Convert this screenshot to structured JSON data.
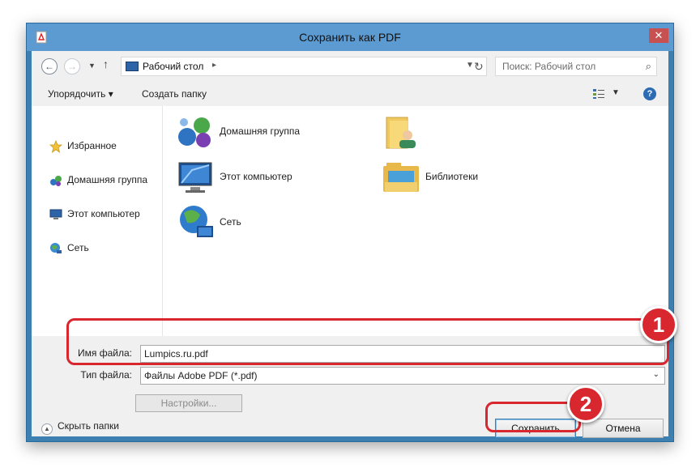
{
  "window": {
    "title": "Сохранить как PDF",
    "close_label": "✕"
  },
  "address_bar": {
    "path": "Рабочий стол",
    "search_placeholder": "Поиск: Рабочий стол"
  },
  "toolbar": {
    "organize": "Упорядочить ▾",
    "new_folder": "Создать папку"
  },
  "nav_pane": [
    {
      "label": "Избранное",
      "icon": "star-icon"
    },
    {
      "label": "Домашняя группа",
      "icon": "homegroup-icon"
    },
    {
      "label": "Этот компьютер",
      "icon": "computer-icon"
    },
    {
      "label": "Сеть",
      "icon": "network-icon"
    }
  ],
  "content_items": [
    {
      "label": "Домашняя группа",
      "icon": "homegroup-icon"
    },
    {
      "label": "",
      "icon": "user-folder-icon"
    },
    {
      "label": "Этот компьютер",
      "icon": "computer-icon"
    },
    {
      "label": "Библиотеки",
      "icon": "libraries-icon"
    },
    {
      "label": "Сеть",
      "icon": "network-icon"
    }
  ],
  "save_form": {
    "filename_label": "Имя файла:",
    "filename_value": "Lumpics.ru.pdf",
    "filetype_label": "Тип файла:",
    "filetype_value": "Файлы Adobe PDF (*.pdf)",
    "settings_button": "Настройки..."
  },
  "footer": {
    "hide_folders": "Скрыть папки",
    "save_button": "Сохранить",
    "cancel_button": "Отмена"
  },
  "annotations": {
    "badge_1": "1",
    "badge_2": "2",
    "color": "#d8272e"
  }
}
